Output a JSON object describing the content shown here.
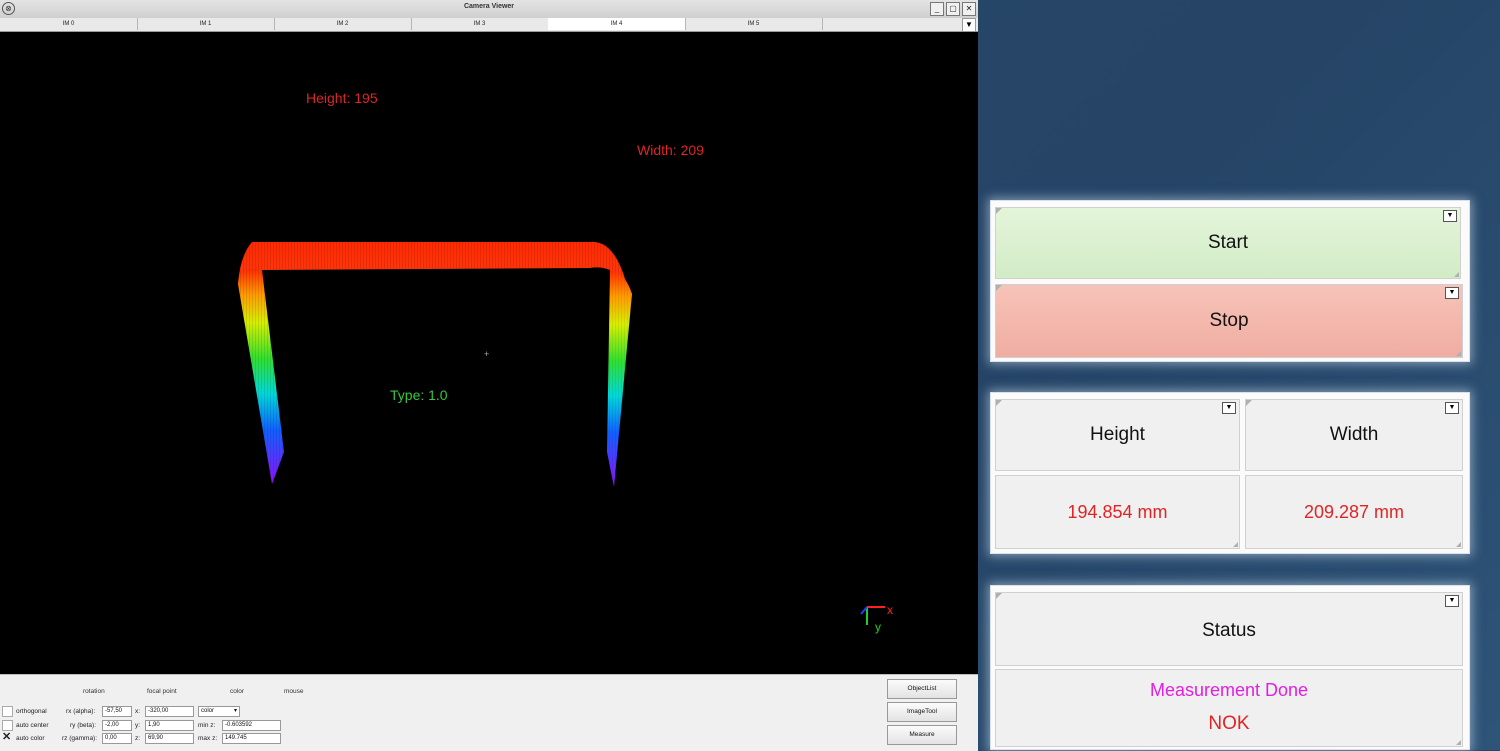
{
  "window": {
    "title": "Camera Viewer",
    "buttons": [
      "_",
      "▢",
      "✕"
    ]
  },
  "tabs": [
    {
      "label": "IM 0"
    },
    {
      "label": "IM 1"
    },
    {
      "label": "IM 2"
    },
    {
      "label": "IM 3"
    },
    {
      "label": "IM 4"
    },
    {
      "label": "IM 5"
    }
  ],
  "active_tab": "IM 4",
  "scene": {
    "height_text": "Height: 195",
    "width_text": "Width: 209",
    "type_text": "Type: 1.0",
    "axis_x": "x",
    "axis_y": "y"
  },
  "controls": {
    "headers": {
      "rotation": "rotation",
      "focal_point": "focal point",
      "color": "color",
      "mouse": "mouse"
    },
    "orthogonal": "orthogonal",
    "auto_center": "auto center",
    "auto_color": "auto color",
    "rx_label": "rx (alpha):",
    "rx_value": "-57,50",
    "ry_label": "ry (beta):",
    "ry_value": "-2,00",
    "rz_label": "rz (gamma):",
    "rz_value": "0,00",
    "x_label": "x:",
    "x_value": "-320,00",
    "y_label": "y:",
    "y_value": "1,90",
    "z_label": "z:",
    "z_value": "69,90",
    "color_select": "color",
    "min_z_label": "min z:",
    "min_z_value": "-0.603592",
    "max_z_label": "max z:",
    "max_z_value": "149.745",
    "auto_color_checked": true,
    "buttons": {
      "objectlist": "ObjectList",
      "imagetool": "ImageTool",
      "measure": "Measure"
    }
  },
  "right": {
    "start_label": "Start",
    "stop_label": "Stop",
    "height_label": "Height",
    "width_label": "Width",
    "height_value": "194.854 mm",
    "width_value": "209.287 mm",
    "status_label": "Status",
    "status_message": "Measurement Done",
    "status_result": "NOK"
  },
  "colors": {
    "start_bg": "#d9f0cf",
    "stop_bg": "#f5b8ad",
    "value_red": "#e02424",
    "status_magenta": "#e020e0"
  }
}
